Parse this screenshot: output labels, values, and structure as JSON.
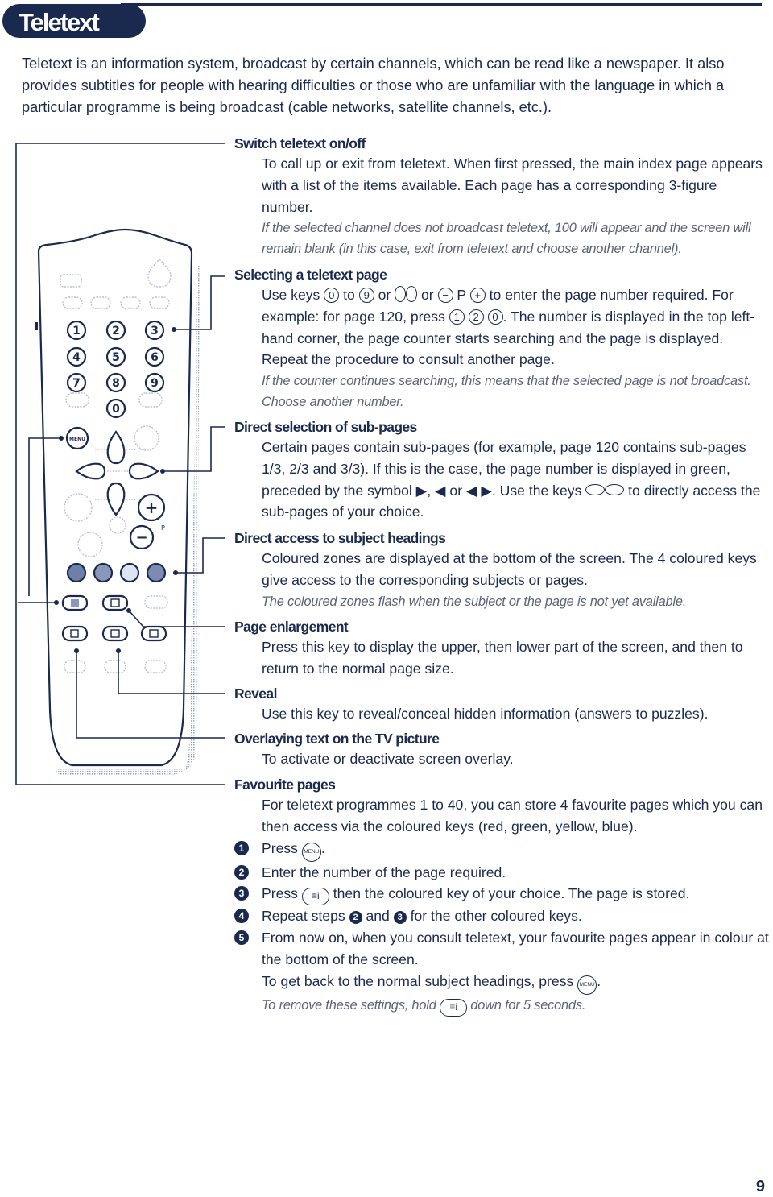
{
  "header": {
    "title": "Teletext"
  },
  "intro": "Teletext is an information system, broadcast by certain channels, which can be read like a newspaper. It also provides subtitles for people with hearing difficulties or those who are unfamiliar with the language in which a particular programme is being broadcast (cable networks, satellite channels, etc.).",
  "sections": {
    "switch": {
      "title": "Switch teletext on/off",
      "body": "To call up or exit from teletext. When first pressed, the main index page appears with a list of the items available. Each page has a corresponding 3-figure number.",
      "note": "If the selected channel does not broadcast teletext, 100 will appear and the screen will remain blank (in this case, exit from teletext and choose another channel)."
    },
    "select": {
      "title": "Selecting a teletext page",
      "t1": "Use keys ",
      "k0": "0",
      "t2": " to ",
      "k9": "9",
      "t3": " or ",
      "t4": " or ",
      "kminus": "−",
      "p": " P ",
      "kplus": "+",
      "t5": " to enter the page number required. For example: for page 120, press ",
      "k1": "1",
      "k2": "2",
      "k0b": "0",
      "t6": ". The number is displayed in the top left-hand corner, the page counter starts searching and the page is displayed. Repeat the procedure to consult another page.",
      "note": "If the counter continues searching, this means that the selected page is not broadcast. Choose another number."
    },
    "subpages": {
      "title": "Direct selection of sub-pages",
      "t1": "Certain pages contain sub-pages (for example, page 120 contains sub-pages 1/3, 2/3 and 3/3). If this is the case, the page number is displayed in green, preceded by the symbol ▶, ◀ or ◀ ▶. Use the keys ",
      "t2": " to directly access the sub-pages of your choice."
    },
    "headings": {
      "title": "Direct access to subject headings",
      "body": "Coloured zones are displayed at the bottom of the screen. The 4 coloured keys give access to the corresponding subjects or pages.",
      "note": "The coloured zones flash when the subject or the page is not yet available."
    },
    "enlarge": {
      "title": "Page enlargement",
      "body": "Press this key to display the upper, then lower part of the screen, and then to return to the normal page size."
    },
    "reveal": {
      "title": "Reveal",
      "body": "Use this key to reveal/conceal hidden information (answers to puzzles)."
    },
    "overlay": {
      "title": "Overlaying text on the TV picture",
      "body": "To activate or deactivate screen overlay."
    },
    "favourites": {
      "title": "Favourite pages",
      "body": "For teletext programmes 1 to 40, you can store 4 favourite pages which you can then access via the coloured keys (red, green, yellow, blue).",
      "menu_key": "MENU",
      "ei_key": "≡i",
      "steps": [
        {
          "num": "1",
          "t1": "Press ",
          "t2": "."
        },
        {
          "num": "2",
          "text": "Enter the number of the page required."
        },
        {
          "num": "3",
          "t1": "Press ",
          "t2": " then the coloured key of your choice. The page is stored."
        },
        {
          "num": "4",
          "t1": "Repeat steps ",
          "b1": "2",
          "t2": " and ",
          "b2": "3",
          "t3": " for the other coloured keys."
        },
        {
          "num": "5",
          "text": "From now on, when you consult teletext, your favourite pages appear in colour at the bottom of the screen."
        }
      ],
      "back_t1": "To get back to the normal subject headings, press ",
      "back_t2": ".",
      "note_t1": "To remove these settings, hold ",
      "note_t2": " down for 5 seconds."
    }
  },
  "remote": {
    "digits": [
      "1",
      "2",
      "3",
      "4",
      "5",
      "6",
      "7",
      "8",
      "9",
      "0"
    ],
    "menu_label": "MENU",
    "plus": "+",
    "minus": "−",
    "p_label": "P",
    "colour_keys": [
      "red",
      "green",
      "yellow",
      "blue"
    ]
  },
  "footer": {
    "page_number": "9"
  },
  "colors": {
    "primary": "#1a2a4e",
    "note": "#5a6478",
    "light": "#b8bfd6"
  }
}
